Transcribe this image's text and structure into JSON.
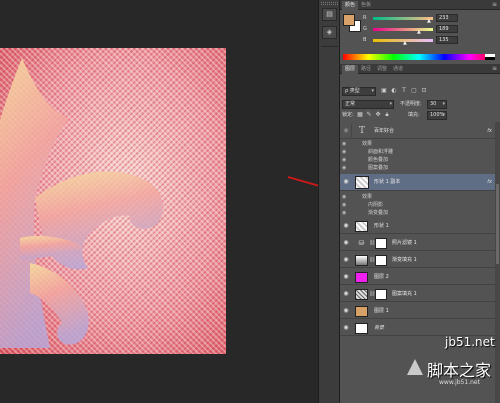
{
  "color_panel": {
    "tabs": [
      "颜色",
      "色板"
    ],
    "channels": [
      {
        "label": "R",
        "value": "233"
      },
      {
        "label": "G",
        "value": "189"
      },
      {
        "label": "B",
        "value": "135"
      }
    ],
    "fg_color": "#d9a26a",
    "bg_color": "#ffffff"
  },
  "layers_panel": {
    "tabs": [
      "图层",
      "路径",
      "调整",
      "通道"
    ],
    "filter_kind": "ρ 类型",
    "blend_mode": "正常",
    "opacity_label": "不透明度:",
    "opacity_value": "30",
    "lock_label": "锁定:",
    "fill_label": "填充:",
    "fill_value": "100%",
    "layers": [
      {
        "name": "百年好合",
        "fx": "fx",
        "kind": "text"
      },
      {
        "sub": "效果"
      },
      {
        "sub": "斜面和浮雕"
      },
      {
        "sub": "颜色叠加"
      },
      {
        "sub": "图案叠加"
      },
      {
        "name": "形状 1 副本",
        "fx": "fx",
        "kind": "shape",
        "selected": true
      },
      {
        "sub": "效果"
      },
      {
        "sub": "内阴影"
      },
      {
        "sub": "渐变叠加"
      },
      {
        "name": "形状 1",
        "kind": "shape"
      },
      {
        "name": "照片滤镜 1",
        "kind": "adjust"
      },
      {
        "name": "渐变填充 1",
        "kind": "gradient"
      },
      {
        "name": "图层 2",
        "kind": "magenta"
      },
      {
        "name": "图案填充 1",
        "kind": "pattern"
      },
      {
        "name": "图层 1",
        "kind": "tan"
      },
      {
        "name": "背景",
        "kind": "white"
      }
    ]
  },
  "watermark": {
    "site": "jb51.net",
    "title": "脚本之家",
    "url": "www.jb51.net"
  }
}
